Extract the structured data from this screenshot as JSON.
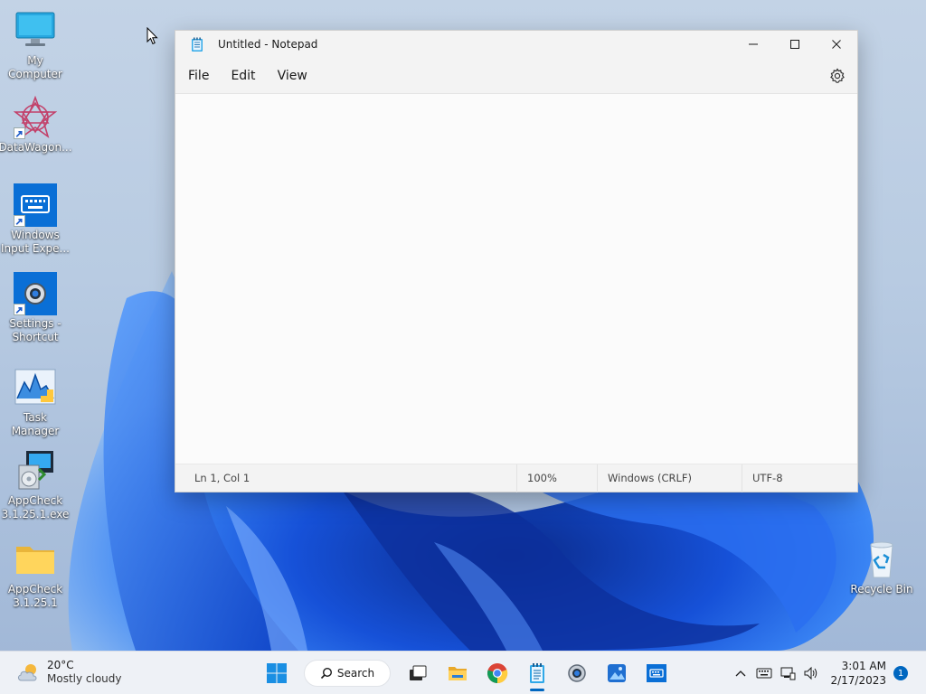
{
  "desktop": {
    "icons": [
      {
        "label": "My Computer"
      },
      {
        "label": "DataWagon..."
      },
      {
        "label": "Windows Input Expe..."
      },
      {
        "label": "Settings - Shortcut"
      },
      {
        "label": "Task Manager"
      },
      {
        "label": "AppCheck 3.1.25.1.exe"
      },
      {
        "label": "AppCheck 3.1.25.1"
      },
      {
        "label": "Recycle Bin"
      }
    ]
  },
  "notepad": {
    "title": "Untitled - Notepad",
    "menu": [
      "File",
      "Edit",
      "View"
    ],
    "editor_text": "",
    "status": {
      "position": "Ln 1, Col 1",
      "zoom": "100%",
      "line_ending": "Windows (CRLF)",
      "encoding": "UTF-8"
    }
  },
  "taskbar": {
    "weather": {
      "temp": "20°C",
      "condition": "Mostly cloudy"
    },
    "search_label": "Search",
    "clock": {
      "time": "3:01 AM",
      "date": "2/17/2023"
    },
    "notification_count": "1"
  },
  "colors": {
    "accent": "#0067c0",
    "wallpaper_blue": "#1a5ce8"
  }
}
